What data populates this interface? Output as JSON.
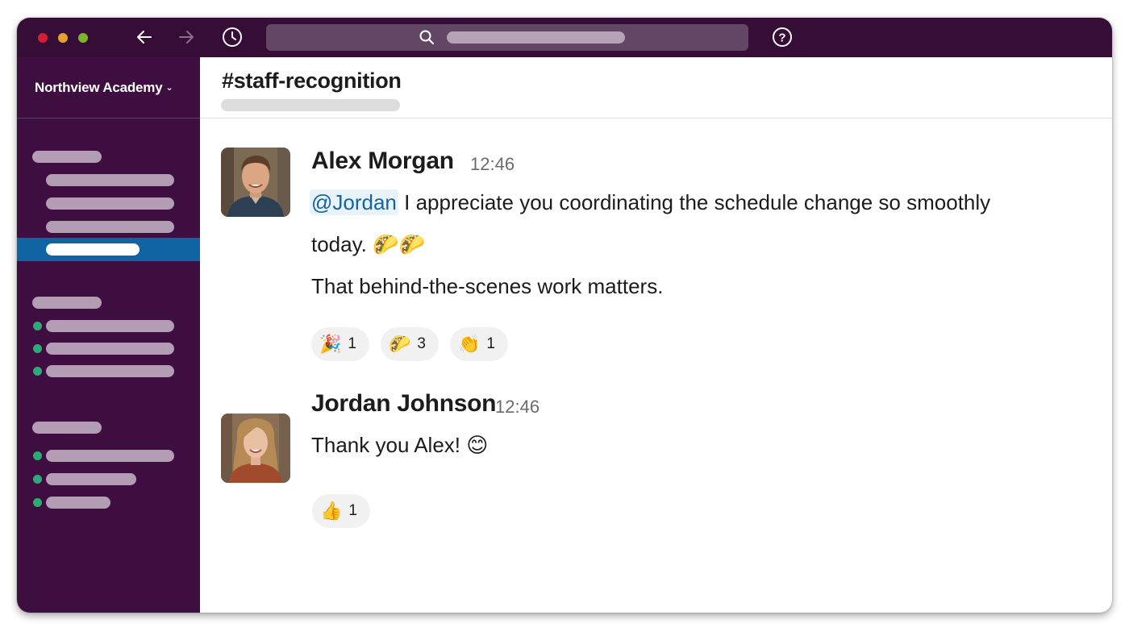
{
  "titlebar": {
    "back_icon": "arrow-left-icon",
    "forward_icon": "arrow-right-icon",
    "history_icon": "clock-icon",
    "search_icon": "search-icon",
    "help_icon": "help-icon",
    "help_glyph": "?"
  },
  "sidebar": {
    "workspace": "Northview Academy",
    "caret": "⌄"
  },
  "channel": {
    "name": "#staff-recognition"
  },
  "messages": [
    {
      "author": "Alex Morgan",
      "time": "12:46",
      "mention": "@Jordan",
      "line1": " I appreciate you coordinating the schedule change so smoothly",
      "line2": "today. ",
      "line2_emoji": "🌮🌮",
      "line3": "That behind-the-scenes work matters.",
      "reactions": [
        {
          "emoji": "🎉",
          "count": "1"
        },
        {
          "emoji": "🌮",
          "count": "3"
        },
        {
          "emoji": "👏",
          "count": "1"
        }
      ]
    },
    {
      "author": "Jordan Johnson",
      "time": "12:46",
      "text": "Thank you Alex! ",
      "emoji": "😊",
      "reactions": [
        {
          "emoji": "👍",
          "count": "1"
        }
      ]
    }
  ],
  "colors": {
    "titlebar": "#350d36",
    "sidebar": "#3f0e40",
    "active": "#1164a3",
    "presence": "#2bac76",
    "mention_text": "#1264a3"
  }
}
